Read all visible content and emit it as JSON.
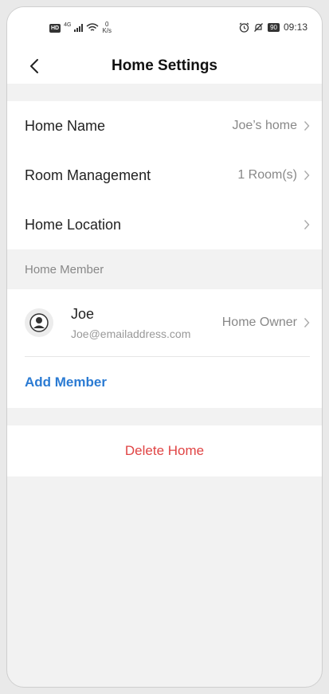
{
  "status_bar": {
    "hd": "HD",
    "network": "4G",
    "speed_value": "0",
    "speed_unit": "K/s",
    "battery": "90",
    "time": "09:13"
  },
  "header": {
    "title": "Home Settings"
  },
  "settings": {
    "home_name_label": "Home Name",
    "home_name_value": "Joe’s home",
    "room_management_label": "Room Management",
    "room_management_value": "1 Room(s)",
    "home_location_label": "Home Location",
    "home_location_value": ""
  },
  "members": {
    "section_title": "Home Member",
    "list": [
      {
        "name": "Joe",
        "email": "Joe@emailaddress.com",
        "role": "Home Owner"
      }
    ],
    "add_member_label": "Add Member"
  },
  "actions": {
    "delete_home_label": "Delete Home"
  },
  "colors": {
    "accent_blue": "#2b7bd3",
    "danger_red": "#e04444",
    "background": "#f2f2f2"
  }
}
